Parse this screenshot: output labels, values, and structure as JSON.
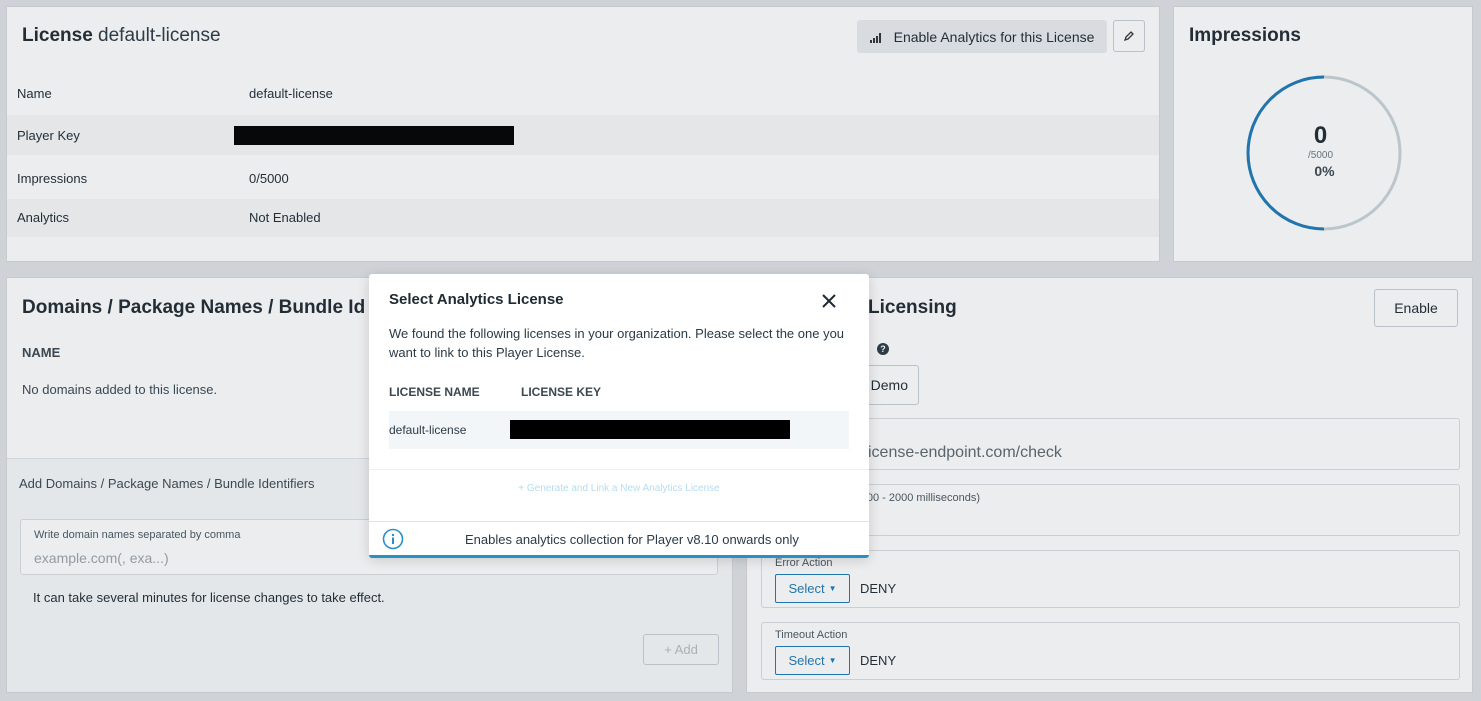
{
  "license_panel": {
    "title_prefix": "License",
    "title_name": "default-license",
    "enable_analytics_label": "Enable Analytics for this License",
    "rows": [
      {
        "label": "Name",
        "value": "default-license"
      },
      {
        "label": "Player Key",
        "value": ""
      },
      {
        "label": "Impressions",
        "value": "0/5000"
      },
      {
        "label": "Analytics",
        "value": "Not Enabled"
      }
    ]
  },
  "impressions_panel": {
    "title": "Impressions",
    "count": "0",
    "limit": "/5000",
    "percent": "0%",
    "usage_fraction": 0,
    "ring_color": "#1f7ab6"
  },
  "domains_panel": {
    "title": "Domains / Package Names / Bundle Id",
    "column_header": "NAME",
    "empty_text": "No domains added to this license.",
    "add_title": "Add Domains / Package Names / Bundle Identifiers",
    "input_label": "Write domain names separated by comma",
    "input_placeholder": "example.com(, exa...)",
    "note": "It can take several minutes for license changes to take effect.",
    "add_label": "+  Add"
  },
  "licensing_panel": {
    "title": "Licensing",
    "enable_label": "Enable",
    "demo_label": "Demo",
    "endpoint_value": "icense-endpoint.com/check",
    "timeout_label": "t (100 - 2000 milliseconds)",
    "error_action_label": "Error Action",
    "error_select": "Select",
    "error_value": "DENY",
    "timeout_action_label": "Timeout Action",
    "timeout_select": "Select",
    "timeout_value": "DENY"
  },
  "modal": {
    "title": "Select Analytics License",
    "description": "We found the following licenses in your organization. Please select the one you want to link to this Player License.",
    "col_license_name": "LICENSE NAME",
    "col_license_key": "LICENSE KEY",
    "rows": [
      {
        "name": "default-license",
        "key": ""
      }
    ],
    "generate_link": "+ Generate and Link a New Analytics License",
    "info_text": "Enables analytics collection for Player v8.10 onwards only"
  }
}
